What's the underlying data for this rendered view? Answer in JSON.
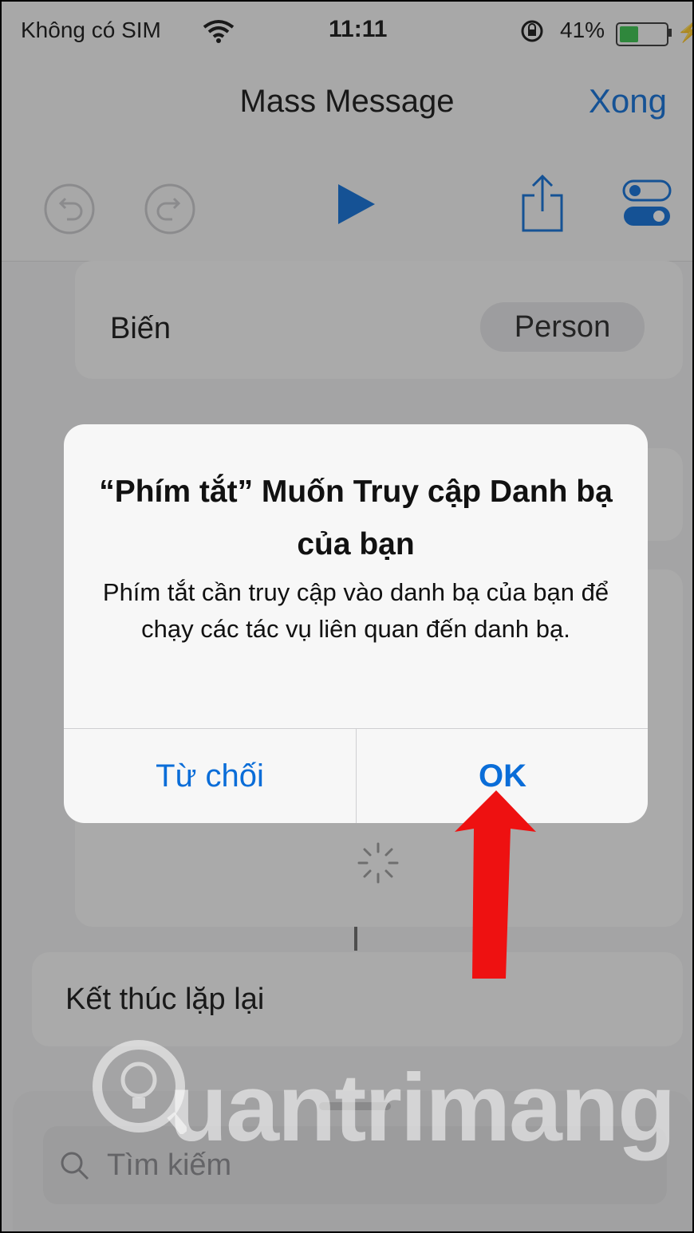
{
  "status_bar": {
    "carrier": "Không có SIM",
    "time": "11:11",
    "battery_percent": "41%",
    "battery_level": 0.41
  },
  "navbar": {
    "title": "Mass Message",
    "done_label": "Xong"
  },
  "toolbar": {
    "icons": [
      "undo-icon",
      "redo-icon",
      "play-icon",
      "share-icon",
      "settings-toggle-icon"
    ]
  },
  "variable_card": {
    "label": "Biến",
    "value": "Person"
  },
  "end_repeat_card": {
    "label": "Kết thúc lặp lại"
  },
  "search": {
    "placeholder": "Tìm kiếm"
  },
  "alert": {
    "title": "“Phím tắt” Muốn Truy cập Danh bạ của bạn",
    "message": "Phím tắt cần truy cập vào danh bạ của bạn để chạy các tác vụ liên quan đến danh bạ.",
    "cancel_label": "Từ chối",
    "ok_label": "OK"
  },
  "watermark": {
    "text": "uantrimang"
  },
  "colors": {
    "accent": "#0a6dd8",
    "arrow": "#ee1111",
    "battery": "#35c24a"
  }
}
